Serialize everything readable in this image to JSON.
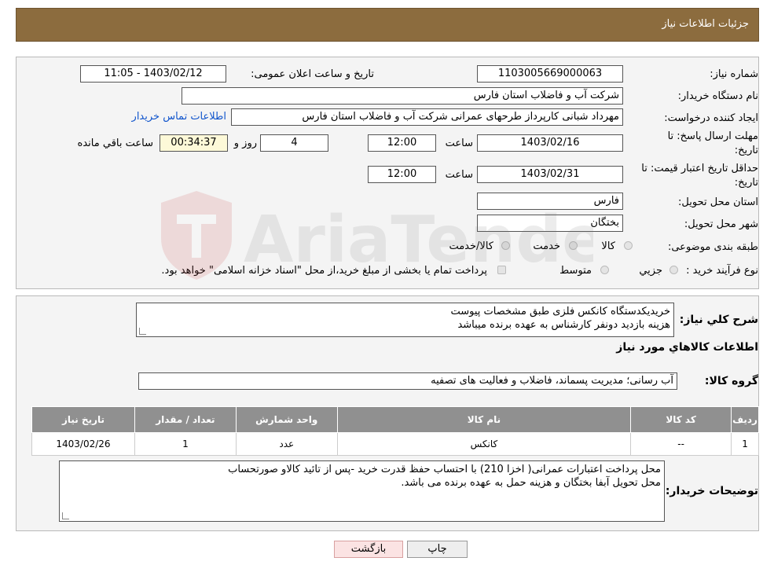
{
  "header": {
    "title": "جزئیات اطلاعات نیاز"
  },
  "details": {
    "need_number_label": "شماره نیاز:",
    "need_number": "1103005669000063",
    "announce_label": "تاریخ و ساعت اعلان عمومی:",
    "announce_value": "1403/02/12 - 11:05",
    "buyer_org_label": "نام دستگاه خریدار:",
    "buyer_org": "شرکت آب و فاضلاب استان فارس",
    "creator_label": "ایجاد کننده درخواست:",
    "creator": "مهرداد شبانی کارپرداز طرحهای عمرانی  شرکت آب و فاضلاب استان فارس",
    "contact_link": "اطلاعات تماس خریدار",
    "deadline_label_1": "مهلت ارسال پاسخ: تا",
    "deadline_label_2": "تاریخ:",
    "deadline_date": "1403/02/16",
    "time_label": "ساعت",
    "deadline_time": "12:00",
    "days_value": "4",
    "days_label": "روز و",
    "remaining_time": "00:34:37",
    "remaining_label": "ساعت باقي مانده",
    "validity_label_1": "حداقل تاریخ اعتبار قیمت: تا",
    "validity_label_2": "تاریخ:",
    "validity_date": "1403/02/31",
    "validity_time": "12:00",
    "province_label": "استان محل تحویل:",
    "province": "فارس",
    "city_label": "شهر محل تحویل:",
    "city": "بختگان",
    "category_label": "طبقه بندی موضوعی:",
    "category_options": [
      "کالا",
      "خدمت",
      "کالا/خدمت"
    ],
    "process_label": "نوع فرآیند خرید :",
    "process_options": [
      "جزيي",
      "متوسط"
    ],
    "process_note": "پرداخت تمام یا بخشی از مبلغ خرید،از محل \"اسناد خزانه اسلامی\" خواهد بود."
  },
  "summary": {
    "label": "شرح کلي نياز:",
    "lines": [
      "خریدیکدستگاه کانکس فلزی طبق مشخصات پیوست",
      "هزینه بازدید دونفر کارشناس به عهده برنده میباشد"
    ],
    "items_title": "اطلاعات کالاهاي مورد نياز",
    "group_label": "گروه کالا:",
    "group_value": "آب رسانی؛ مدیریت پسماند، فاضلاب و فعالیت های تصفیه"
  },
  "table": {
    "headers": [
      "رديف",
      "کد کالا",
      "نام کالا",
      "واحد شمارش",
      "تعداد / مقدار",
      "تاریخ نیاز"
    ],
    "rows": [
      [
        "1",
        "--",
        "کانکس",
        "عدد",
        "1",
        "1403/02/26"
      ]
    ]
  },
  "buyer_notes": {
    "label": "توضیحات خریدار:",
    "lines": [
      "محل پرداخت اعتبارات عمرانی( اخزا 210) با احتساب حفظ قدرت خرید -پس از تائید کالاو صورتحساب",
      "محل تحویل  آبفا بختگان و هزینه حمل به عهده برنده می باشد."
    ]
  },
  "buttons": {
    "print": "چاپ",
    "back": "بازگشت"
  },
  "watermark": {
    "text": "AriaTender.neT"
  }
}
